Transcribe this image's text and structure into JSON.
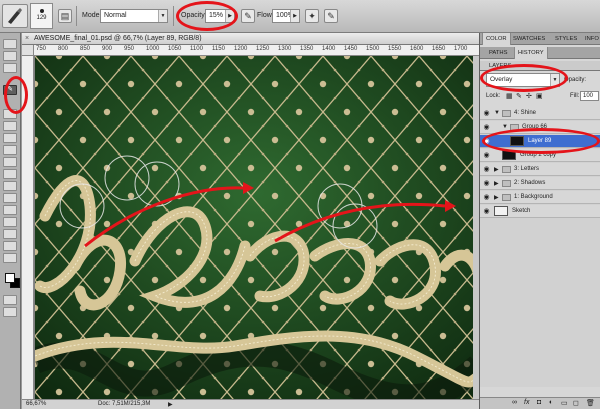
{
  "options_bar": {
    "brush_size": "129",
    "mode_label": "Mode:",
    "mode_value": "Normal",
    "opacity_label": "Opacity:",
    "opacity_value": "15%",
    "flow_label": "Flow:",
    "flow_value": "100%"
  },
  "document": {
    "tab_title": "AWESOME_final_01.psd @ 66,7% (Layer 89, RGB/8)",
    "ruler_marks": [
      "750",
      "800",
      "850",
      "900",
      "950",
      "1000",
      "1050",
      "1100",
      "1150",
      "1200",
      "1250",
      "1300",
      "1350",
      "1400",
      "1450",
      "1500",
      "1550",
      "1600",
      "1650",
      "1700"
    ],
    "zoom": "66,67%",
    "doc_size": "Doc: 7,51M/215,3M"
  },
  "panels": {
    "top_tabs": [
      "COLOR",
      "SWATCHES",
      "STYLES",
      "INFO"
    ],
    "second_tabs": [
      "PATHS",
      "HISTORY"
    ],
    "layers_title": "LAYERS",
    "blend_mode": "Overlay",
    "opacity_label": "Opacity:",
    "lock_label": "Lock:",
    "fill_label": "Fill:",
    "fill_value": "100",
    "layers": [
      {
        "name": "4: Shine",
        "kind": "group"
      },
      {
        "name": "Group 66",
        "kind": "group"
      },
      {
        "name": "Layer 89",
        "kind": "layer",
        "selected": true
      },
      {
        "name": "Group 2 copy",
        "kind": "layer"
      },
      {
        "name": "3: Letters",
        "kind": "group"
      },
      {
        "name": "2: Shadows",
        "kind": "group"
      },
      {
        "name": "1: Background",
        "kind": "group"
      },
      {
        "name": "Sketch",
        "kind": "layer"
      }
    ],
    "bottom_icons": [
      "link-icon",
      "fx-icon",
      "mask-icon",
      "adjustment-icon",
      "folder-icon",
      "new-layer-icon",
      "trash-icon"
    ]
  },
  "colors": {
    "highlight": "#e4141a",
    "canvas_green": "#1f4d21",
    "lettering": "#cdbd8e"
  }
}
